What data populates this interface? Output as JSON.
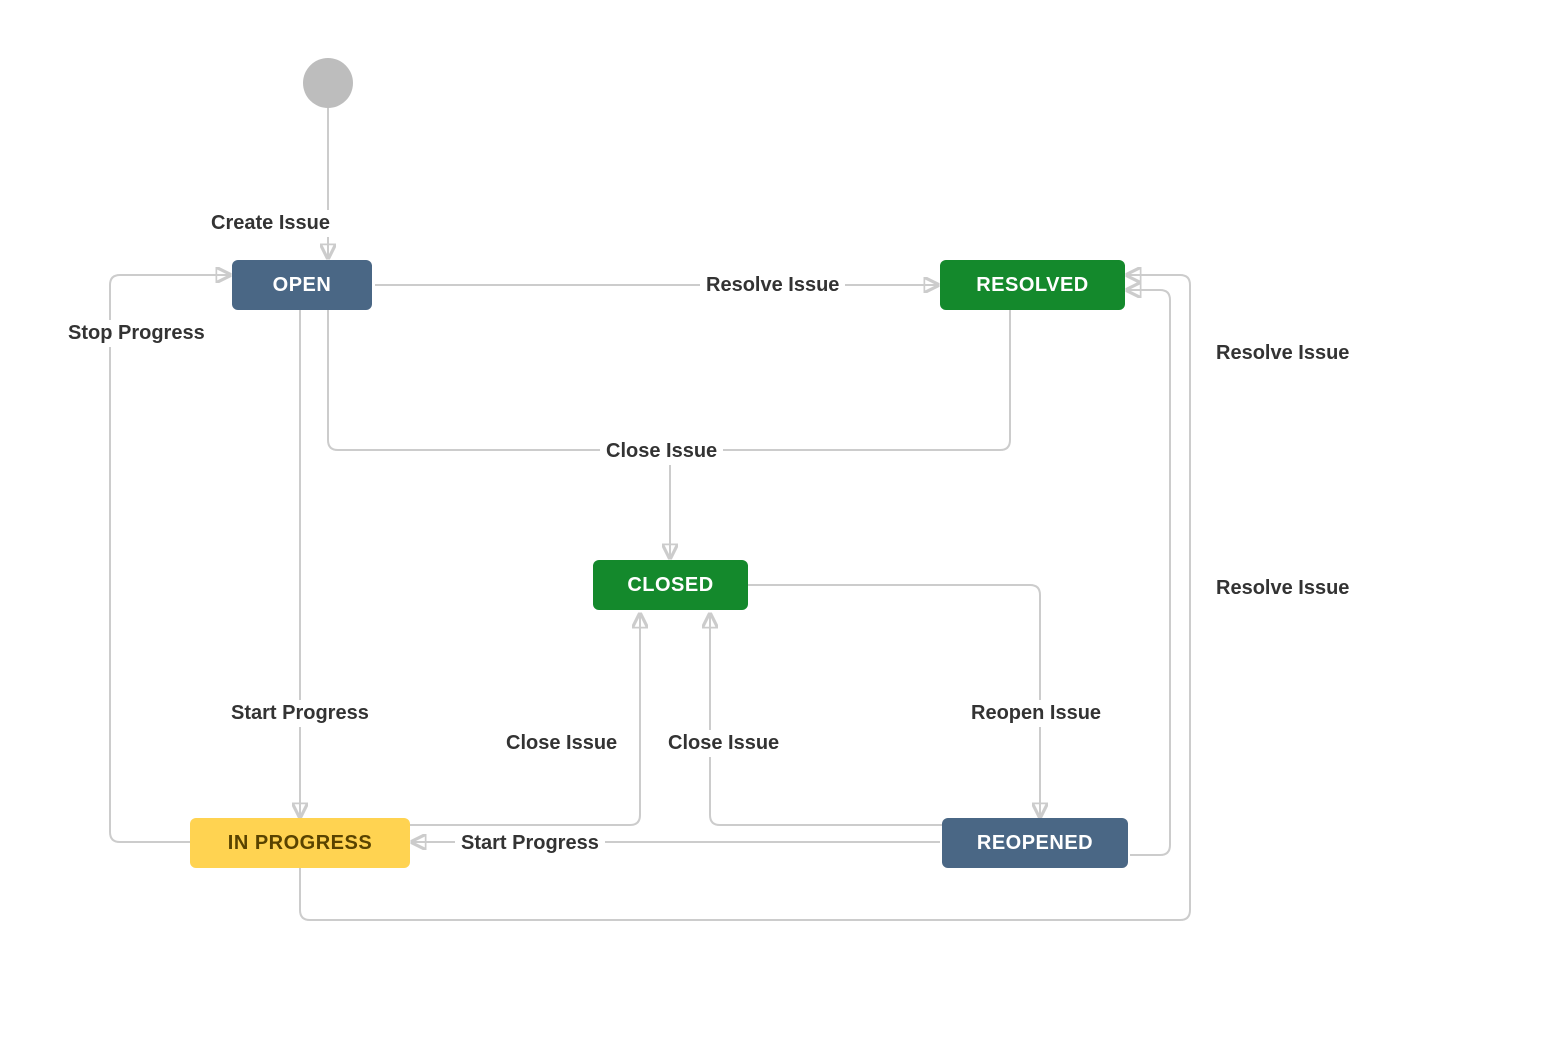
{
  "nodes": {
    "open": {
      "label": "OPEN"
    },
    "resolved": {
      "label": "RESOLVED"
    },
    "closed": {
      "label": "CLOSED"
    },
    "in_progress": {
      "label": "IN PROGRESS"
    },
    "reopened": {
      "label": "REOPENED"
    }
  },
  "edges": {
    "create_issue": "Create Issue",
    "resolve_issue_1": "Resolve Issue",
    "resolve_issue_2": "Resolve Issue",
    "resolve_issue_3": "Resolve Issue",
    "close_issue_top": "Close Issue",
    "close_issue_left": "Close Issue",
    "close_issue_right": "Close Issue",
    "stop_progress": "Stop Progress",
    "start_progress_left": "Start Progress",
    "start_progress_bottom": "Start Progress",
    "reopen_issue": "Reopen Issue"
  },
  "chart_data": {
    "type": "state-diagram",
    "start": "START",
    "states": [
      {
        "id": "OPEN",
        "color": "#4a6785",
        "text_color": "#ffffff"
      },
      {
        "id": "RESOLVED",
        "color": "#14892c",
        "text_color": "#ffffff"
      },
      {
        "id": "CLOSED",
        "color": "#14892c",
        "text_color": "#ffffff"
      },
      {
        "id": "IN PROGRESS",
        "color": "#ffd351",
        "text_color": "#594300"
      },
      {
        "id": "REOPENED",
        "color": "#4a6785",
        "text_color": "#ffffff"
      }
    ],
    "transitions": [
      {
        "from": "START",
        "to": "OPEN",
        "label": "Create Issue"
      },
      {
        "from": "OPEN",
        "to": "RESOLVED",
        "label": "Resolve Issue"
      },
      {
        "from": "OPEN",
        "to": "CLOSED",
        "label": "Close Issue"
      },
      {
        "from": "RESOLVED",
        "to": "CLOSED",
        "label": "Close Issue"
      },
      {
        "from": "OPEN",
        "to": "IN PROGRESS",
        "label": "Start Progress"
      },
      {
        "from": "IN PROGRESS",
        "to": "OPEN",
        "label": "Stop Progress"
      },
      {
        "from": "IN PROGRESS",
        "to": "CLOSED",
        "label": "Close Issue"
      },
      {
        "from": "IN PROGRESS",
        "to": "RESOLVED",
        "label": "Resolve Issue"
      },
      {
        "from": "CLOSED",
        "to": "REOPENED",
        "label": "Reopen Issue"
      },
      {
        "from": "REOPENED",
        "to": "IN PROGRESS",
        "label": "Start Progress"
      },
      {
        "from": "REOPENED",
        "to": "CLOSED",
        "label": "Close Issue"
      },
      {
        "from": "REOPENED",
        "to": "RESOLVED",
        "label": "Resolve Issue"
      }
    ]
  }
}
